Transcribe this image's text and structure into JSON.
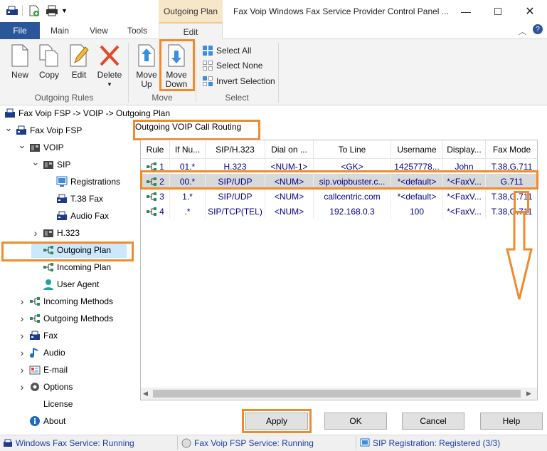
{
  "window": {
    "title": "Fax Voip Windows Fax Service Provider Control Panel ...",
    "context_tab": "Outgoing Plan"
  },
  "tabs": [
    "File",
    "Main",
    "View",
    "Tools",
    "Edit"
  ],
  "ribbon": {
    "outgoing_rules": {
      "label": "Outgoing Rules",
      "new": "New",
      "copy": "Copy",
      "edit": "Edit",
      "delete": "Delete"
    },
    "move": {
      "label": "Move",
      "up_1": "Move",
      "up_2": "Up",
      "down_1": "Move",
      "down_2": "Down"
    },
    "select": {
      "label": "Select",
      "all": "Select All",
      "none": "Select None",
      "invert": "Invert Selection"
    }
  },
  "breadcrumb": "Fax Voip FSP -> VOIP -> Outgoing Plan",
  "tree": [
    {
      "label": "Fax Voip FSP",
      "indent": 0,
      "arrow": "open",
      "icon": "fax-icon"
    },
    {
      "label": "VOIP",
      "indent": 1,
      "arrow": "open",
      "icon": "phone-icon"
    },
    {
      "label": "SIP",
      "indent": 2,
      "arrow": "open",
      "icon": "phone-icon"
    },
    {
      "label": "Registrations",
      "indent": 3,
      "arrow": "",
      "icon": "registration-icon"
    },
    {
      "label": "T.38 Fax",
      "indent": 3,
      "arrow": "",
      "icon": "fax-icon"
    },
    {
      "label": "Audio Fax",
      "indent": 3,
      "arrow": "",
      "icon": "fax-icon"
    },
    {
      "label": "H.323",
      "indent": 2,
      "arrow": "closed",
      "icon": "phone-icon"
    },
    {
      "label": "Outgoing Plan",
      "indent": 2,
      "arrow": "",
      "icon": "routing-icon",
      "selected": true
    },
    {
      "label": "Incoming Plan",
      "indent": 2,
      "arrow": "",
      "icon": "routing-icon"
    },
    {
      "label": "User Agent",
      "indent": 2,
      "arrow": "",
      "icon": "user-icon"
    },
    {
      "label": "Incoming Methods",
      "indent": 1,
      "arrow": "closed",
      "icon": "routing-icon"
    },
    {
      "label": "Outgoing Methods",
      "indent": 1,
      "arrow": "closed",
      "icon": "routing-icon"
    },
    {
      "label": "Fax",
      "indent": 1,
      "arrow": "closed",
      "icon": "fax-icon"
    },
    {
      "label": "Audio",
      "indent": 1,
      "arrow": "closed",
      "icon": "music-note-icon"
    },
    {
      "label": "E-mail",
      "indent": 1,
      "arrow": "closed",
      "icon": "email-icon"
    },
    {
      "label": "Options",
      "indent": 1,
      "arrow": "closed",
      "icon": "gear-icon"
    },
    {
      "label": "License",
      "indent": 1,
      "arrow": "",
      "icon": "key-icon"
    },
    {
      "label": "About",
      "indent": 1,
      "arrow": "",
      "icon": "info-icon"
    }
  ],
  "panel_title": "Outgoing VOIP Call Routing",
  "table": {
    "columns": [
      "Rule",
      "If Nu...",
      "SIP/H.323",
      "Dial on ...",
      "To Line",
      "Username",
      "Display...",
      "Fax Mode"
    ],
    "rows": [
      [
        "1",
        "01.*",
        "H.323",
        "<NUM-1>",
        "<GK>",
        "14257778...",
        "John",
        "T.38,G.711"
      ],
      [
        "2",
        "00.*",
        "SIP/UDP",
        "<NUM>",
        "sip.voipbuster.c...",
        "*<default>",
        "*<FaxV...",
        "G.711"
      ],
      [
        "3",
        "1.*",
        "SIP/UDP",
        "<NUM>",
        "callcentric.com",
        "*<default>",
        "*<FaxV...",
        "T.38,G.711"
      ],
      [
        "4",
        ".*",
        "SIP/TCP(TEL)",
        "<NUM>",
        "192.168.0.3",
        "100",
        "*<FaxV...",
        "T.38,G.711"
      ]
    ],
    "selected_row": 1
  },
  "buttons": {
    "apply": "Apply",
    "ok": "OK",
    "cancel": "Cancel",
    "help": "Help"
  },
  "status": {
    "fax_service": "Windows Fax Service: Running",
    "fsp_service": "Fax Voip FSP Service: Running",
    "sip_registration": "SIP Registration: Registered (3/3)"
  },
  "colors": {
    "file_tab": "#2b579a",
    "highlight": "#f08a2c",
    "context_tab": "#f6e7c8",
    "link_text": "#00008b"
  }
}
